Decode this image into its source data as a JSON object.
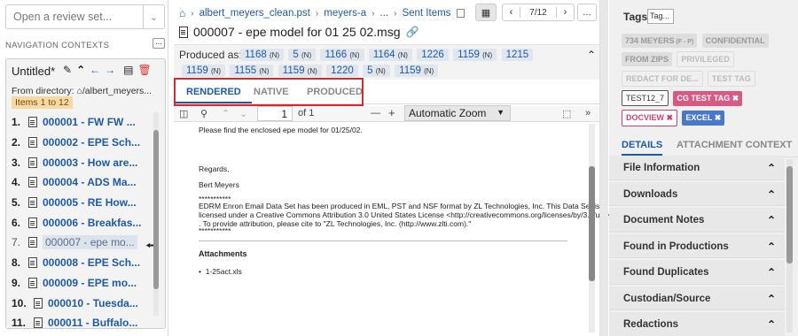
{
  "left": {
    "review_placeholder": "Open a review set...",
    "nav_contexts_label": "NAVIGATION CONTEXTS",
    "nav_more": "...",
    "context": {
      "title": "Untitled*",
      "from_directory": "From directory: ⌂/albert_meyers...",
      "items_badge": "Items 1 to 12"
    },
    "docs": [
      {
        "num": "1.",
        "label": "000001 - FW  FW ..."
      },
      {
        "num": "2.",
        "label": "000002 - EPE Sch..."
      },
      {
        "num": "3.",
        "label": "000003 - How are..."
      },
      {
        "num": "4.",
        "label": "000004 - ADS Ma..."
      },
      {
        "num": "5.",
        "label": "000005 - RE  How..."
      },
      {
        "num": "6.",
        "label": "000006 - Breakfas..."
      },
      {
        "num": "7.",
        "label": "000007 - epe mo..."
      },
      {
        "num": "8.",
        "label": "000008 - EPE Sch..."
      },
      {
        "num": "9.",
        "label": "000009 - EPE mo..."
      },
      {
        "num": "10.",
        "label": "000010 - Tuesda..."
      },
      {
        "num": "11.",
        "label": "000011 - Buffalo..."
      }
    ]
  },
  "mid": {
    "breadcrumb": [
      "albert_meyers_clean.pst",
      "meyers-a",
      "...",
      "Sent Items"
    ],
    "page_counter": "7/12",
    "more": "...",
    "doc_title": "000007 - epe model for 01 25 02.msg",
    "produced_label": "Produced as:",
    "productions_row1": [
      {
        "n": "1168",
        "t": "(N)"
      },
      {
        "n": "5",
        "t": "(N)"
      },
      {
        "n": "1166",
        "t": "(N)"
      },
      {
        "n": "1164",
        "t": "(N)"
      },
      {
        "n": "1226",
        "t": ""
      },
      {
        "n": "1159",
        "t": "(N)"
      },
      {
        "n": "1215",
        "t": ""
      }
    ],
    "productions_row2": [
      {
        "n": "1159",
        "t": "(N)"
      },
      {
        "n": "1155",
        "t": "(N)"
      },
      {
        "n": "1159",
        "t": "(N)"
      },
      {
        "n": "1220",
        "t": ""
      },
      {
        "n": "5",
        "t": "(N)"
      },
      {
        "n": "1159",
        "t": "(N)"
      }
    ],
    "tabs": [
      "RENDERED",
      "NATIVE",
      "PRODUCED"
    ],
    "viewer": {
      "page": "1",
      "of": "of 1",
      "zoom": "Automatic Zoom",
      "minus": "—",
      "plus": "+"
    },
    "body": {
      "line1": "Please find the enclosed epe model for 01/25/02.",
      "regards": "Regards,",
      "sign": "Bert Meyers",
      "stars": "***********",
      "edrm1": "EDRM Enron Email Data Set has been produced in EML, PST and NSF format by ZL Technologies, Inc. This Data Set is",
      "edrm2": "licensed under a Creative Commons Attribution 3.0 United States License <http://creativecommons.org/licenses/by/3.0/us/>",
      "edrm3": ". To provide attribution, please cite to \"ZL Technologies, Inc. (http://www.zlti.com).\"",
      "stars2": "***********",
      "attachments": "Attachments",
      "att1": "1-25act.xls"
    }
  },
  "right": {
    "tags_label": "Tags",
    "tag_input": "Tag...",
    "tags": [
      {
        "label": "734 MEYERS",
        "suffix": " (F - P)",
        "style": "grey"
      },
      {
        "label": "CONFIDENTIAL",
        "style": "grey"
      },
      {
        "label": "FROM ZIPS",
        "style": "grey"
      },
      {
        "label": "PRIVILEGED",
        "style": "grey-o"
      },
      {
        "label": "REDACT FOR DE...",
        "style": "grey-o"
      },
      {
        "label": "TEST TAG",
        "style": "grey-o"
      },
      {
        "label": "TEST12_7",
        "style": "outline"
      },
      {
        "label": "CG TEST TAG ✖",
        "style": "pink"
      },
      {
        "label": "DOCVIEW ✖",
        "style": "pink-o"
      },
      {
        "label": "EXCEL ✖",
        "style": "blue"
      }
    ],
    "tabs": [
      "DETAILS",
      "ATTACHMENT CONTEXT"
    ],
    "sections": [
      "File Information",
      "Downloads",
      "Document Notes",
      "Found in Productions",
      "Found Duplicates",
      "Custodian/Source",
      "Redactions"
    ]
  }
}
